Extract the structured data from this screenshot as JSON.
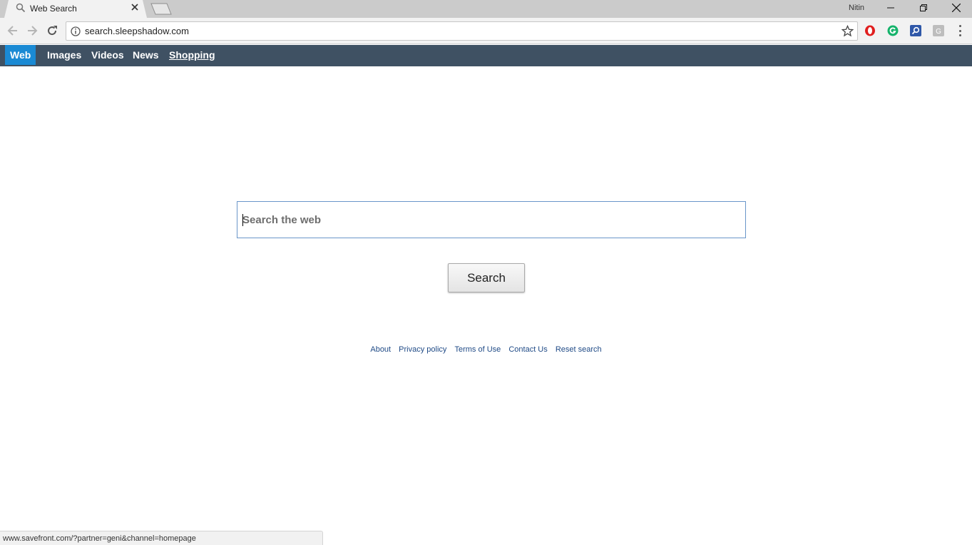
{
  "browser": {
    "tab_title": "Web Search",
    "profile_name": "Nitin",
    "url": "search.sleepshadow.com",
    "status_url": "www.savefront.com/?partner=geni&channel=homepage",
    "icons": {
      "tab_favicon": "magnifier-icon",
      "close": "close-icon",
      "back": "back-arrow-icon",
      "forward": "forward-arrow-icon",
      "reload": "reload-icon",
      "info": "info-icon",
      "star": "star-icon",
      "extensions": [
        "opera-extension-icon",
        "grammarly-extension-icon",
        "search-extension-icon",
        "g-extension-icon"
      ],
      "menu": "vertical-dots-icon"
    }
  },
  "nav": {
    "items": [
      {
        "label": "Web"
      },
      {
        "label": "Images"
      },
      {
        "label": "Videos"
      },
      {
        "label": "News"
      },
      {
        "label": "Shopping"
      }
    ]
  },
  "search": {
    "placeholder": "Search the web",
    "button_label": "Search"
  },
  "footer": {
    "links": [
      "About",
      "Privacy policy",
      "Terms of Use",
      "Contact Us",
      "Reset search"
    ]
  },
  "colors": {
    "nav_bg": "#3f5163",
    "nav_active": "#1a8ad4",
    "link": "#1f4a86"
  }
}
